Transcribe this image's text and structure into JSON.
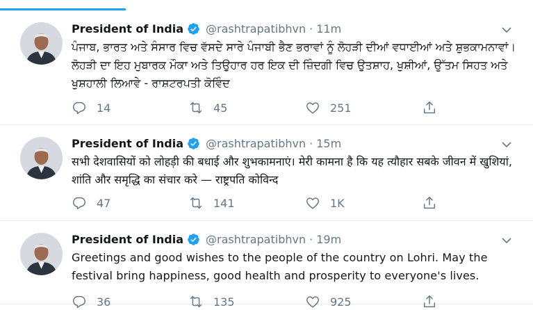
{
  "colors": {
    "accent": "#1da1f2",
    "muted": "#657786",
    "text": "#14171a",
    "border": "#e6ecf0"
  },
  "tweets": [
    {
      "name": "President of India",
      "handle": "@rashtrapatibhvn",
      "separator": "·",
      "time": "11m",
      "text": "ਪੰਜਾਬ, ਭਾਰਤ ਅਤੇ ਸੰਸਾਰ ਵਿਚ ਵੱਸਦੇ ਸਾਰੇ ਪੰਜਾਬੀ ਭੈਣ ਭਰਾਵਾਂ ਨੂੰ ਲੋਹੜੀ ਦੀਆਂ ਵਧਾਈਆਂ ਅਤੇ ਸ਼ੁਭਕਾਮਨਾਵਾਂ। ਲੋਹੜੀ ਦਾ ਇਹ ਮੁਬਾਰਕ ਮੌਕਾ ਅਤੇ ਤਿਉਹਾਰ ਹਰ ਇਕ ਦੀ ਜ਼ਿੰਦਗੀ ਵਿਚ ਉਤਸ਼ਾਹ, ਖੁਸ਼ੀਆਂ, ਉੱਤਮ ਸਿਹਤ ਅਤੇ ਖੁਸ਼ਹਾਲੀ ਲਿਆਵੇ - ਰਾਸ਼ਟਰਪਤੀ ਕੋਵਿੰਦ",
      "replies": "14",
      "retweets": "45",
      "likes": "251"
    },
    {
      "name": "President of India",
      "handle": "@rashtrapatibhvn",
      "separator": "·",
      "time": "15m",
      "text": "सभी देशवासियों को लोहड़ी की बधाई और शुभकामनाएं। मेरी कामना है कि यह त्यौहार सबके जीवन में खुशियां, शांति और समृद्धि का संचार करे — राष्ट्रपति कोविन्द",
      "replies": "47",
      "retweets": "141",
      "likes": "1K"
    },
    {
      "name": "President of India",
      "handle": "@rashtrapatibhvn",
      "separator": "·",
      "time": "19m",
      "text": "Greetings and good wishes to the people of the country on Lohri. May the festival bring happiness, good health and prosperity to everyone's lives.",
      "replies": "36",
      "retweets": "135",
      "likes": "925"
    }
  ],
  "icons": {
    "reply": "reply-icon",
    "retweet": "retweet-icon",
    "like": "like-icon",
    "share": "share-icon",
    "verified": "verified-badge-icon",
    "caret": "chevron-down-icon"
  }
}
